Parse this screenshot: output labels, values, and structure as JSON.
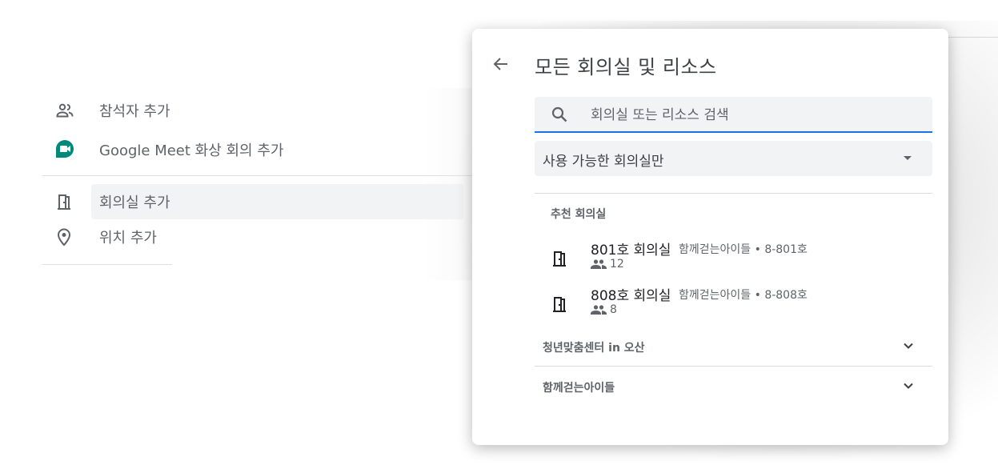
{
  "editor": {
    "add_guests": "참석자 추가",
    "add_meet": "Google Meet 화상 회의 추가",
    "add_room": "회의실 추가",
    "add_location": "위치 추가"
  },
  "dialog": {
    "title": "모든 회의실 및 리소스",
    "search_placeholder": "회의실 또는 리소스 검색",
    "filter_value": "사용 가능한 회의실만",
    "section_title": "추천 회의실",
    "rooms": [
      {
        "name": "801호 회의실",
        "meta": "함께걷는아이들 • 8-801호",
        "capacity": "12"
      },
      {
        "name": "808호 회의실",
        "meta": "함께걷는아이들 • 8-808호",
        "capacity": "8"
      }
    ],
    "groups": [
      {
        "label": "청년맞춤센터 in 오산"
      },
      {
        "label": "함께걷는아이들"
      }
    ]
  },
  "colors": {
    "accent": "#1a73e8",
    "meet_green": "#00897b",
    "field_bg": "#f1f3f4",
    "text_primary": "#202124",
    "text_secondary": "#5f6368"
  }
}
